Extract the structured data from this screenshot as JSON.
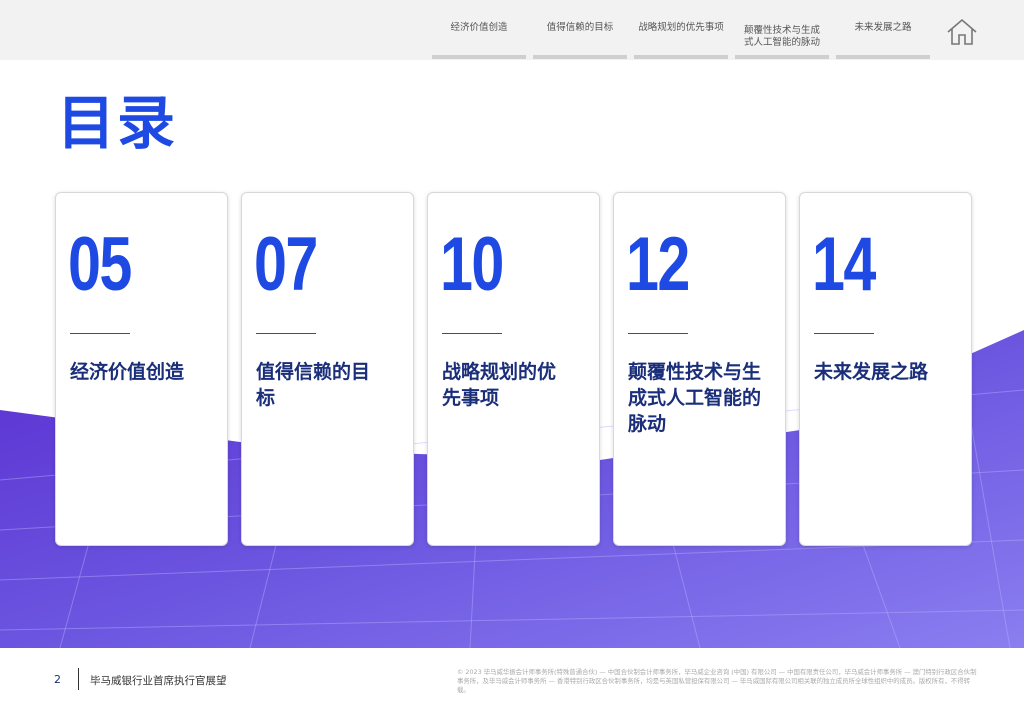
{
  "nav": {
    "items": [
      {
        "label": "经济价值创造"
      },
      {
        "label": "值得信赖的目标"
      },
      {
        "label": "战略规划的优先事项"
      },
      {
        "label": "颠覆性技术与生成式人工智能的脉动"
      },
      {
        "label": "未来发展之路"
      }
    ]
  },
  "title": "目录",
  "cards": [
    {
      "num": "05",
      "text": "经济价值创造"
    },
    {
      "num": "07",
      "text": "值得信赖的目标"
    },
    {
      "num": "10",
      "text": "战略规划的优先事项"
    },
    {
      "num": "12",
      "text": "颠覆性技术与生成式人工智能的脉动"
    },
    {
      "num": "14",
      "text": "未来发展之路"
    }
  ],
  "footer": {
    "page": "2",
    "title": "毕马威银行业首席执行官展望",
    "legal": "© 2023 毕马威华振会计师事务所(特殊普通合伙) — 中国合伙制会计师事务所，毕马威企业咨询 (中国) 有限公司 — 中国有限责任公司，毕马威会计师事务所 — 澳门特别行政区合伙制事务所，及毕马威会计师事务所 — 香港特别行政区合伙制事务所，均是与英国私营担保有限公司 — 毕马威国际有限公司相关联的独立成员所全球性组织中的成员。版权所有，不得转载。"
  },
  "colors": {
    "accent": "#1e49e2",
    "dark": "#1a2e7a"
  }
}
